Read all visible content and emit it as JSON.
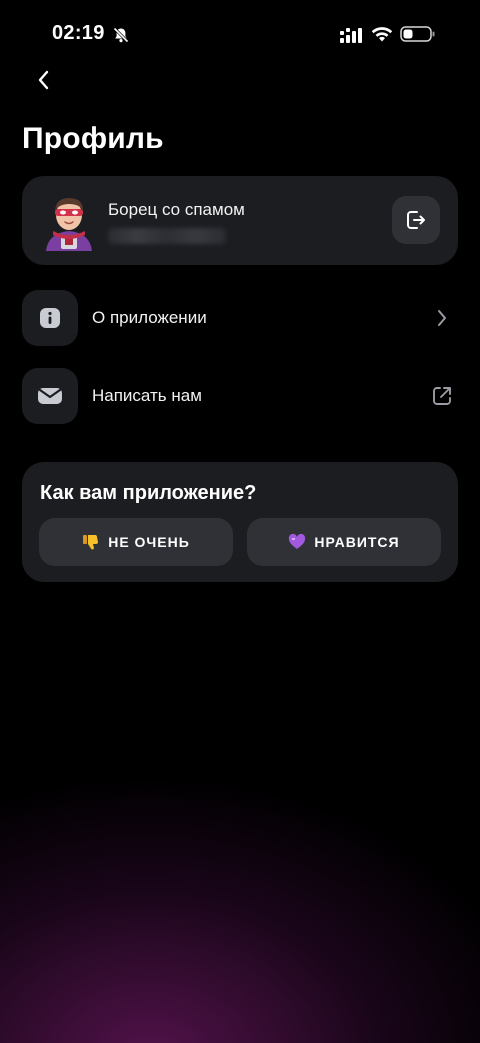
{
  "status_bar": {
    "time": "02:19"
  },
  "page": {
    "title": "Профиль"
  },
  "profile": {
    "name": "Борец со спамом"
  },
  "menu": [
    {
      "label": "О приложении",
      "icon": "info-icon",
      "trailing": "chevron-right-icon"
    },
    {
      "label": "Написать нам",
      "icon": "mail-icon",
      "trailing": "external-link-icon"
    }
  ],
  "rating": {
    "question": "Как вам приложение?",
    "dislike_label": "НЕ ОЧЕНЬ",
    "like_label": "НРАВИТСЯ"
  },
  "colors": {
    "background": "#000000",
    "card": "#1c1d21",
    "button": "#2f3136",
    "glow": "#6e1964"
  }
}
